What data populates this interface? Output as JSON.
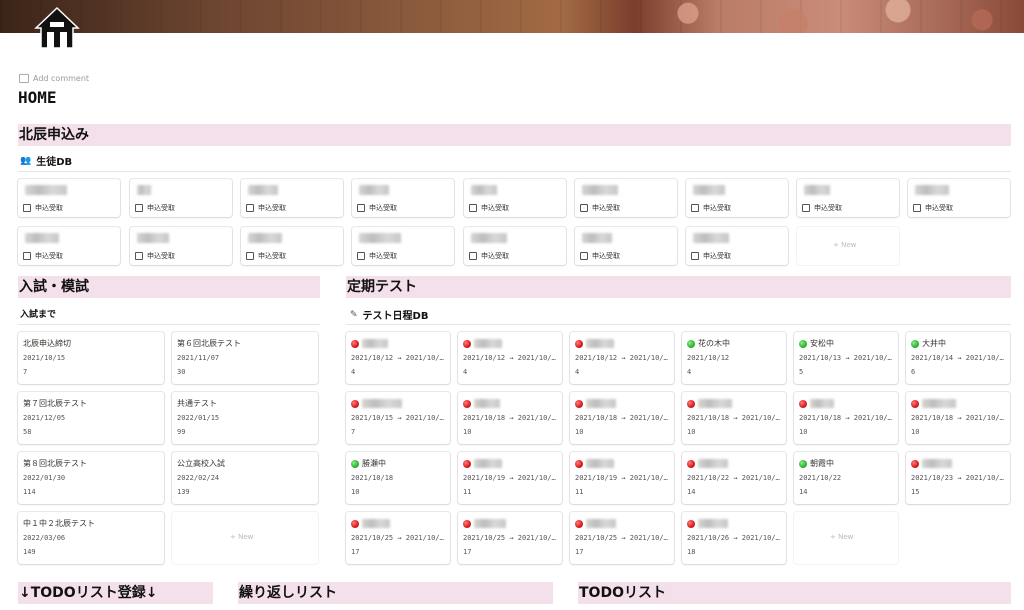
{
  "page": {
    "title": "HOME",
    "add_comment": "Add comment"
  },
  "hokushin": {
    "heading": "北辰申込み",
    "db_title": "生徒DB",
    "checkbox_label": "申込受取",
    "new_label": "+ New"
  },
  "exams": {
    "heading": "入試・模試",
    "subtitle": "入試まで",
    "new_label": "+ New",
    "cards": [
      {
        "title": "北辰申込締切",
        "date": "2021/10/15",
        "days": "7"
      },
      {
        "title": "第６回北辰テスト",
        "date": "2021/11/07",
        "days": "30"
      },
      {
        "title": "第７回北辰テスト",
        "date": "2021/12/05",
        "days": "58"
      },
      {
        "title": "共通テスト",
        "date": "2022/01/15",
        "days": "99"
      },
      {
        "title": "第８回北辰テスト",
        "date": "2022/01/30",
        "days": "114"
      },
      {
        "title": "公立高校入試",
        "date": "2022/02/24",
        "days": "139"
      },
      {
        "title": "中１中２北辰テスト",
        "date": "2022/03/06",
        "days": "149"
      }
    ]
  },
  "teiki": {
    "heading": "定期テスト",
    "db_title": "テスト日程DB",
    "new_label": "+ New",
    "cards": [
      {
        "status": "red",
        "name": "",
        "date": "2021/10/12 → 2021/10/…",
        "num": "4"
      },
      {
        "status": "red",
        "name": "",
        "date": "2021/10/12 → 2021/10/…",
        "num": "4"
      },
      {
        "status": "red",
        "name": "",
        "date": "2021/10/12 → 2021/10/…",
        "num": "4"
      },
      {
        "status": "green",
        "name": "花の木中",
        "date": "2021/10/12",
        "num": "4"
      },
      {
        "status": "green",
        "name": "安松中",
        "date": "2021/10/13 → 2021/10/…",
        "num": "5"
      },
      {
        "status": "green",
        "name": "大井中",
        "date": "2021/10/14 → 2021/10/…",
        "num": "6"
      },
      {
        "status": "red",
        "name": "",
        "date": "2021/10/15 → 2021/10/…",
        "num": "7"
      },
      {
        "status": "red",
        "name": "",
        "date": "2021/10/18 → 2021/10/…",
        "num": "10"
      },
      {
        "status": "red",
        "name": "",
        "date": "2021/10/18 → 2021/10/…",
        "num": "10"
      },
      {
        "status": "red",
        "name": "",
        "date": "2021/10/18 → 2021/10/…",
        "num": "10"
      },
      {
        "status": "red",
        "name": "",
        "date": "2021/10/18 → 2021/10/…",
        "num": "10"
      },
      {
        "status": "red",
        "name": "",
        "date": "2021/10/18 → 2021/10/…",
        "num": "10"
      },
      {
        "status": "green",
        "name": "勝瀬中",
        "date": "2021/10/18",
        "num": "10"
      },
      {
        "status": "red",
        "name": "",
        "date": "2021/10/19 → 2021/10/…",
        "num": "11"
      },
      {
        "status": "red",
        "name": "",
        "date": "2021/10/19 → 2021/10/…",
        "num": "11"
      },
      {
        "status": "red",
        "name": "",
        "date": "2021/10/22 → 2021/10/…",
        "num": "14"
      },
      {
        "status": "green",
        "name": "朝霞中",
        "date": "2021/10/22",
        "num": "14"
      },
      {
        "status": "red",
        "name": "",
        "date": "2021/10/23 → 2021/10/…",
        "num": "15"
      },
      {
        "status": "red",
        "name": "",
        "date": "2021/10/25 → 2021/10/…",
        "num": "17"
      },
      {
        "status": "red",
        "name": "",
        "date": "2021/10/25 → 2021/10/…",
        "num": "17"
      },
      {
        "status": "red",
        "name": "",
        "date": "2021/10/25 → 2021/10/…",
        "num": "17"
      },
      {
        "status": "red",
        "name": "",
        "date": "2021/10/26 → 2021/10/…",
        "num": "18"
      }
    ]
  },
  "bottom": {
    "todo_register": "↓TODOリスト登録↓",
    "repeat_list": "繰り返しリスト",
    "todo_list": "TODOリスト"
  }
}
